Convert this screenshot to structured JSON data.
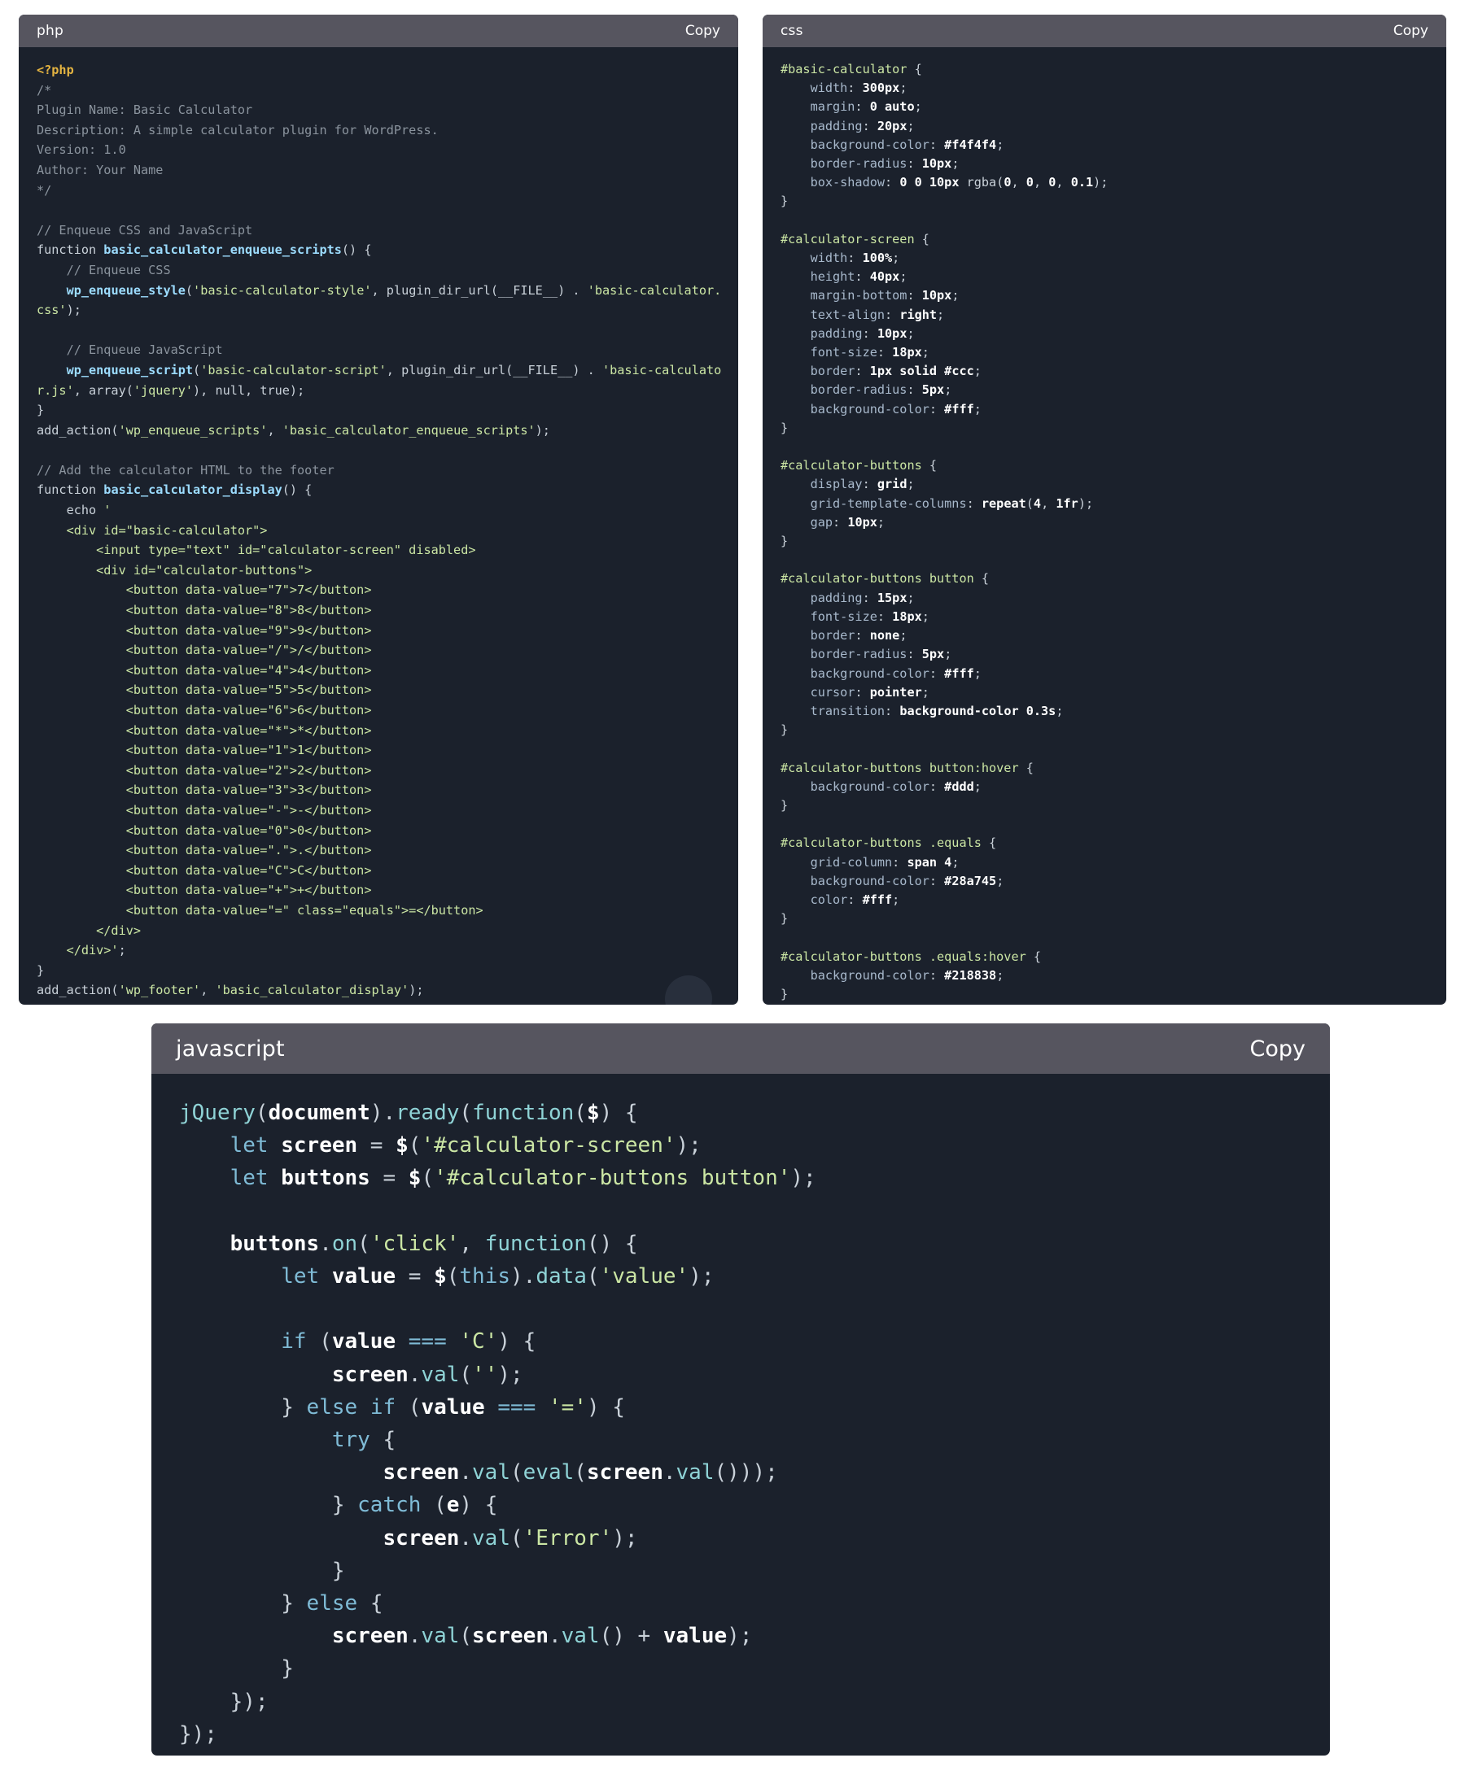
{
  "cards": {
    "php": {
      "language": "php",
      "copy_label": "Copy",
      "lines": [
        "<?php",
        "/*",
        "Plugin Name: Basic Calculator",
        "Description: A simple calculator plugin for WordPress.",
        "Version: 1.0",
        "Author: Your Name",
        "*/",
        "",
        "// Enqueue CSS and JavaScript",
        "function basic_calculator_enqueue_scripts() {",
        "    // Enqueue CSS",
        "    wp_enqueue_style('basic-calculator-style', plugin_dir_url(__FILE__) . 'basic-calculator.css');",
        "",
        "    // Enqueue JavaScript",
        "    wp_enqueue_script('basic-calculator-script', plugin_dir_url(__FILE__) . 'basic-calculator.js', array('jquery'), null, true);",
        "}",
        "add_action('wp_enqueue_scripts', 'basic_calculator_enqueue_scripts');",
        "",
        "// Add the calculator HTML to the footer",
        "function basic_calculator_display() {",
        "    echo '",
        "    <div id=\"basic-calculator\">",
        "        <input type=\"text\" id=\"calculator-screen\" disabled>",
        "        <div id=\"calculator-buttons\">",
        "            <button data-value=\"7\">7</button>",
        "            <button data-value=\"8\">8</button>",
        "            <button data-value=\"9\">9</button>",
        "            <button data-value=\"/\">/</button>",
        "            <button data-value=\"4\">4</button>",
        "            <button data-value=\"5\">5</button>",
        "            <button data-value=\"6\">6</button>",
        "            <button data-value=\"*\">*</button>",
        "            <button data-value=\"1\">1</button>",
        "            <button data-value=\"2\">2</button>",
        "            <button data-value=\"3\">3</button>",
        "            <button data-value=\"-\">-</button>",
        "            <button data-value=\"0\">0</button>",
        "            <button data-value=\".\">.</button>",
        "            <button data-value=\"C\">C</button>",
        "            <button data-value=\"+\">+</button>",
        "            <button data-value=\"=\" class=\"equals\">=</button>",
        "        </div>",
        "    </div>';",
        "}",
        "add_action('wp_footer', 'basic_calculator_display');"
      ]
    },
    "css": {
      "language": "css",
      "copy_label": "Copy",
      "lines": [
        "#basic-calculator {",
        "    width: 300px;",
        "    margin: 0 auto;",
        "    padding: 20px;",
        "    background-color: #f4f4f4;",
        "    border-radius: 10px;",
        "    box-shadow: 0 0 10px rgba(0, 0, 0, 0.1);",
        "}",
        "",
        "#calculator-screen {",
        "    width: 100%;",
        "    height: 40px;",
        "    margin-bottom: 10px;",
        "    text-align: right;",
        "    padding: 10px;",
        "    font-size: 18px;",
        "    border: 1px solid #ccc;",
        "    border-radius: 5px;",
        "    background-color: #fff;",
        "}",
        "",
        "#calculator-buttons {",
        "    display: grid;",
        "    grid-template-columns: repeat(4, 1fr);",
        "    gap: 10px;",
        "}",
        "",
        "#calculator-buttons button {",
        "    padding: 15px;",
        "    font-size: 18px;",
        "    border: none;",
        "    border-radius: 5px;",
        "    background-color: #fff;",
        "    cursor: pointer;",
        "    transition: background-color 0.3s;",
        "}",
        "",
        "#calculator-buttons button:hover {",
        "    background-color: #ddd;",
        "}",
        "",
        "#calculator-buttons .equals {",
        "    grid-column: span 4;",
        "    background-color: #28a745;",
        "    color: #fff;",
        "}",
        "",
        "#calculator-buttons .equals:hover {",
        "    background-color: #218838;",
        "}"
      ]
    },
    "javascript": {
      "language": "javascript",
      "copy_label": "Copy",
      "lines": [
        "jQuery(document).ready(function($) {",
        "    let screen = $('#calculator-screen');",
        "    let buttons = $('#calculator-buttons button');",
        "",
        "    buttons.on('click', function() {",
        "        let value = $(this).data('value');",
        "",
        "        if (value === 'C') {",
        "            screen.val('');",
        "        } else if (value === '=') {",
        "            try {",
        "                screen.val(eval(screen.val()));",
        "            } catch (e) {",
        "                screen.val('Error');",
        "            }",
        "        } else {",
        "            screen.val(screen.val() + value);",
        "        }",
        "    });",
        "});"
      ]
    }
  },
  "colors": {
    "card_background": "#1b212c",
    "header_background": "#56555f",
    "page_background": "#ffffff",
    "comment": "#8b949e",
    "string": "#cbe6a4",
    "keyword": "#7fbbd6",
    "php_open_tag": "#e3b341"
  }
}
